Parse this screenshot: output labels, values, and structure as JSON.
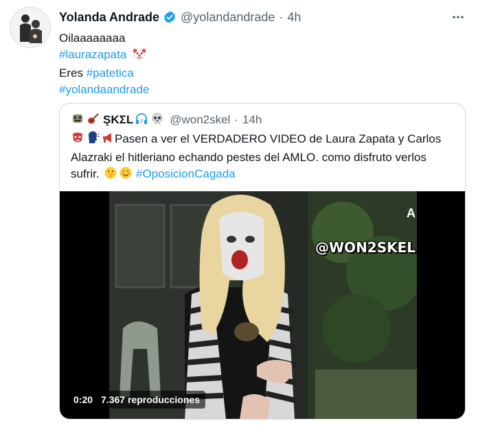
{
  "tweet": {
    "author": {
      "name": "Yolanda Andrade",
      "handle": "@yolandandrade",
      "time": "4h",
      "verified_color": "#1d9bf0"
    },
    "lines": [
      {
        "text": "Oilaaaaaaaa"
      },
      {
        "hashtag": "#laurazapata",
        "emoji": "clown-face-icon"
      },
      {
        "prefix": "Eres ",
        "hashtag": "#patetica"
      },
      {
        "hashtag": "#yolandaandrade"
      }
    ],
    "more_icon": "ellipsis-icon"
  },
  "quote": {
    "author": {
      "name": "ŞKΣL",
      "name_icons": [
        "alien-monster-icon",
        "guitar-icon",
        "headphone-music-icon",
        "skull-icon"
      ],
      "handle": "@won2skel",
      "time": "14h"
    },
    "text_lead_icons": [
      "goblin-mask-icon",
      "speaking-head-icon",
      "megaphone-icon"
    ],
    "text_part1": "Pasen a ver el VERDADERO VIDEO de Laura Zapata y Carlos Alazraki  el hitleriano echando pestes del AMLO. como disfruto verlos sufrir.",
    "text_emojis": [
      "shushing-face-icon",
      "smiling-face-icon"
    ],
    "hashtag": "#OposicionCagada",
    "video": {
      "watermark": "@WON2SKEL",
      "corner_mark": "A",
      "duration": "0:20",
      "views": "7.367 reproducciones"
    }
  },
  "colors": {
    "link": "#1d9bf0",
    "secondary_text": "#536471",
    "border": "#cfd9de"
  }
}
